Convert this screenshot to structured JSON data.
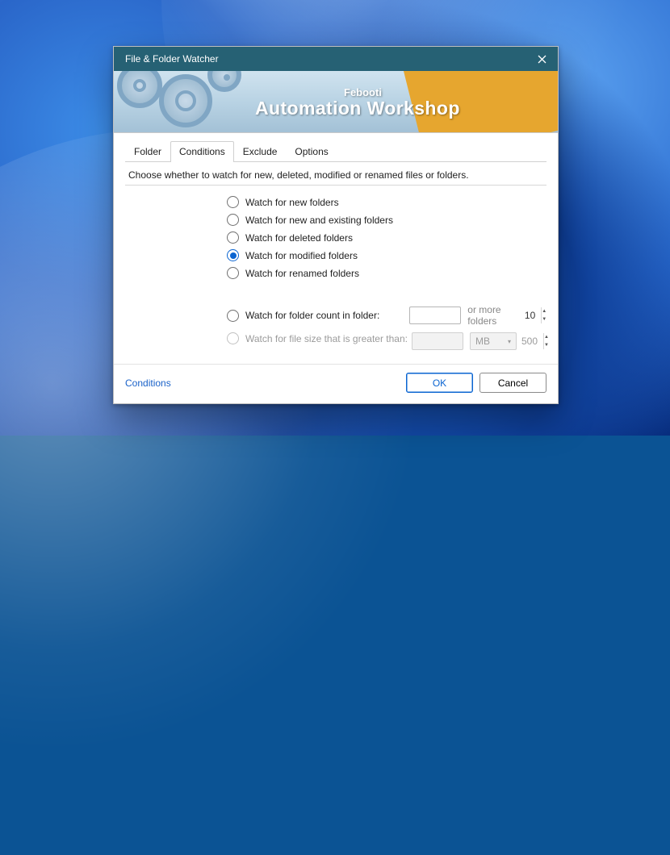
{
  "window": {
    "title": "File & Folder Watcher",
    "banner_brand": "Febooti",
    "banner_main": "Automation Workshop"
  },
  "tabs": [
    {
      "label": "Folder",
      "active": false
    },
    {
      "label": "Conditions",
      "active": true
    },
    {
      "label": "Exclude",
      "active": false
    },
    {
      "label": "Options",
      "active": false
    }
  ],
  "help_text": "Choose whether to watch for new, deleted, modified or renamed files or folders.",
  "options": [
    {
      "label": "Watch for new folders",
      "checked": false
    },
    {
      "label": "Watch for new and existing folders",
      "checked": false
    },
    {
      "label": "Watch for deleted folders",
      "checked": false
    },
    {
      "label": "Watch for modified folders",
      "checked": true
    },
    {
      "label": "Watch for renamed folders",
      "checked": false
    }
  ],
  "ext": {
    "count_label": "Watch for folder count in folder:",
    "count_value": "10",
    "count_suffix": "or more folders",
    "size_label": "Watch for file size that is greater than:",
    "size_value": "500",
    "size_unit": "MB"
  },
  "footer": {
    "corner_link": "Conditions",
    "ok_label": "OK",
    "cancel_label": "Cancel"
  }
}
